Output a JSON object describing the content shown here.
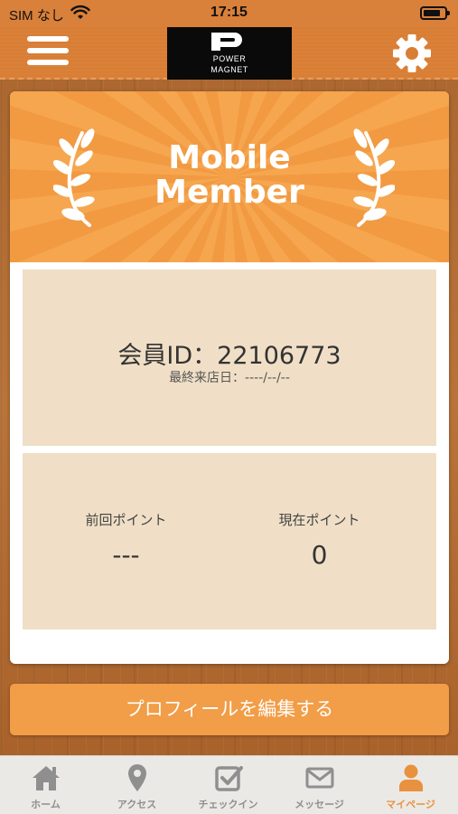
{
  "status_bar": {
    "carrier": "SIM なし",
    "time": "17:15"
  },
  "header": {
    "logo_line1": "POWER",
    "logo_line2": "MAGNET"
  },
  "banner": {
    "line1": "Mobile",
    "line2": "Member"
  },
  "member": {
    "id_text": "会員ID：22106773",
    "last_visit_text": "最終来店日：----/--/--"
  },
  "points": {
    "previous_label": "前回ポイント",
    "previous_value": "---",
    "current_label": "現在ポイント",
    "current_value": "0"
  },
  "edit_profile_label": "プロフィールを編集する",
  "tabs": [
    {
      "label": "ホーム",
      "icon": "home-icon"
    },
    {
      "label": "アクセス",
      "icon": "map-pin-icon"
    },
    {
      "label": "チェックイン",
      "icon": "checkbox-icon"
    },
    {
      "label": "メッセージ",
      "icon": "mail-icon"
    },
    {
      "label": "マイページ",
      "icon": "person-icon"
    }
  ],
  "colors": {
    "accent": "#f29d47",
    "header": "#d97e35",
    "panel": "#f0dfc6",
    "active_tab": "#e8913e"
  }
}
